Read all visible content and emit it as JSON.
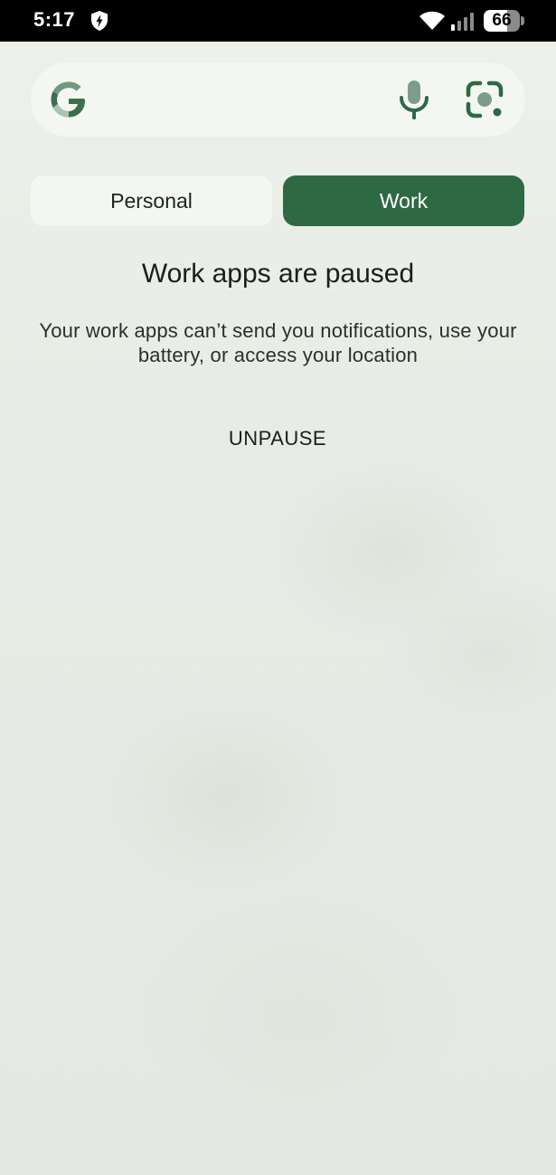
{
  "status_bar": {
    "time": "5:17",
    "battery_level": "66",
    "battery_fraction": 0.66
  },
  "search": {
    "logo_icon": "google-g-icon",
    "mic_icon": "microphone-icon",
    "lens_icon": "camera-lens-icon"
  },
  "tabs": [
    {
      "label": "Personal",
      "selected": false
    },
    {
      "label": "Work",
      "selected": true
    }
  ],
  "message": {
    "title": "Work apps are paused",
    "description": "Your work apps can’t send you notifications, use your battery, or access your location",
    "action_label": "UNPAUSE"
  },
  "colors": {
    "accent": "#2e6944",
    "surface": "#f4f7f1",
    "background": "#e9ece6"
  }
}
